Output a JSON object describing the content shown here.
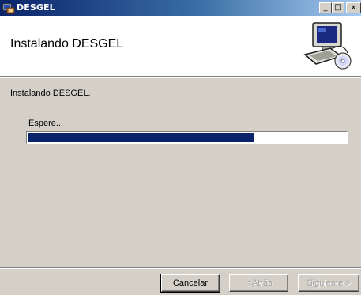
{
  "window": {
    "title": "DESGEL",
    "minimize_glyph": "_",
    "maximize_glyph": "□",
    "close_glyph": "x"
  },
  "header": {
    "title": "Instalando DESGEL",
    "icon": "computer-setup-icon"
  },
  "main": {
    "status_text": "Instalando DESGEL.",
    "progress_label": "Espere...",
    "progress_fraction": 0.71
  },
  "buttons": {
    "cancel": "Cancelar",
    "back": "< Atrás",
    "next": "Siguiente >"
  },
  "colors": {
    "titlebar_start": "#0a246a",
    "progress_fill": "#0a246a",
    "face": "#d4d0c8"
  }
}
